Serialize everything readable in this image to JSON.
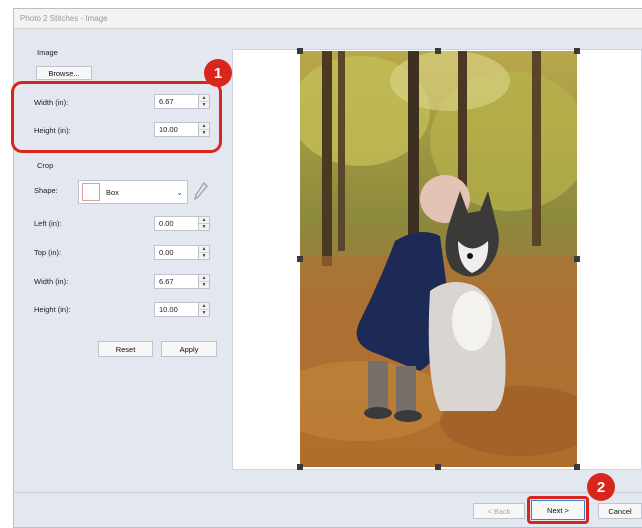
{
  "window": {
    "title": "Photo 2 Stitches - Image"
  },
  "image_section": {
    "label": "Image",
    "browse_label": "Browse...",
    "width_label": "Width (in):",
    "width_value": "6.67",
    "height_label": "Height (in):",
    "height_value": "10.00"
  },
  "crop_section": {
    "label": "Crop",
    "shape_label": "Shape:",
    "shape_value": "Box",
    "left_label": "Left (in):",
    "left_value": "0.00",
    "top_label": "Top (in):",
    "top_value": "0.00",
    "width_label": "Width (in):",
    "width_value": "6.67",
    "height_label": "Height (in):",
    "height_value": "10.00",
    "reset_label": "Reset",
    "apply_label": "Apply"
  },
  "annotations": {
    "badge1": "1",
    "badge2": "2"
  },
  "footer": {
    "back_label": "< Back",
    "next_label": "Next >",
    "cancel_label": "Cancel"
  },
  "colors": {
    "annotation_red": "#d9261c",
    "window_bg": "#e3e7ef"
  },
  "icons": [
    "chevron-down-icon",
    "pencil-icon",
    "spin-up-icon",
    "spin-down-icon"
  ]
}
